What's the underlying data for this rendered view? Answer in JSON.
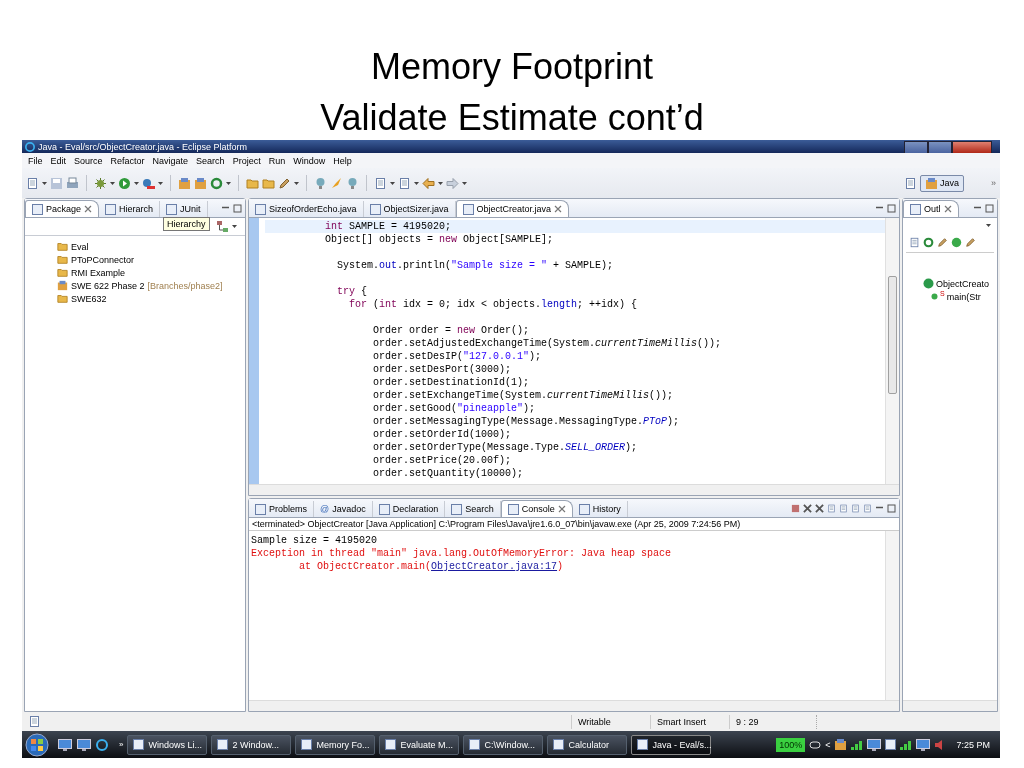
{
  "slide": {
    "title": "Memory Footprint",
    "subtitle": "Validate Estimate cont’d"
  },
  "window": {
    "title": "Java - Eval/src/ObjectCreator.java - Eclipse Platform"
  },
  "menu": [
    "File",
    "Edit",
    "Source",
    "Refactor",
    "Navigate",
    "Search",
    "Project",
    "Run",
    "Window",
    "Help"
  ],
  "perspective": {
    "label": "Java",
    "selected": true,
    "more": "»"
  },
  "package_explorer": {
    "tabs": [
      {
        "label": "Package",
        "selected": true,
        "closable": true
      },
      {
        "label": "Hierarch",
        "selected": false,
        "closable": false
      },
      {
        "label": "JUnit",
        "selected": false,
        "closable": false
      }
    ],
    "tooltip": "Hierarchy",
    "tree": [
      {
        "label": "Eval",
        "kind": "project"
      },
      {
        "label": "PToPConnector",
        "kind": "folder"
      },
      {
        "label": "RMI Example",
        "kind": "folder"
      },
      {
        "label": "SWE 622 Phase 2",
        "decoration": "[Branches/phase2]",
        "kind": "shared"
      },
      {
        "label": "SWE632",
        "kind": "project"
      }
    ]
  },
  "editor": {
    "tabs": [
      {
        "label": "SizeofOrderEcho.java",
        "selected": false,
        "closable": false
      },
      {
        "label": "ObjectSizer.java",
        "selected": false,
        "closable": false
      },
      {
        "label": "ObjectCreator.java",
        "selected": true,
        "closable": true
      }
    ],
    "lines": [
      {
        "kind": "code",
        "current": true,
        "tokens": [
          {
            "text": "          int",
            "kind": "keyword"
          },
          {
            "text": " SAMPLE = 4195020;",
            "kind": "plain"
          }
        ]
      },
      {
        "kind": "code",
        "current": false,
        "tokens": [
          {
            "text": "          Object[] objects = ",
            "kind": "plain"
          },
          {
            "text": "new",
            "kind": "keyword"
          },
          {
            "text": " Object[SAMPLE];",
            "kind": "plain"
          }
        ]
      },
      {
        "kind": "blank"
      },
      {
        "kind": "code",
        "current": false,
        "tokens": [
          {
            "text": "            System.",
            "kind": "plain"
          },
          {
            "text": "out",
            "kind": "field"
          },
          {
            "text": ".println(",
            "kind": "plain"
          },
          {
            "text": "\"Sample size = \"",
            "kind": "string"
          },
          {
            "text": " + SAMPLE);",
            "kind": "plain"
          }
        ]
      },
      {
        "kind": "blank"
      },
      {
        "kind": "code",
        "current": false,
        "tokens": [
          {
            "text": "            try",
            "kind": "keyword"
          },
          {
            "text": " {",
            "kind": "plain"
          }
        ]
      },
      {
        "kind": "code",
        "current": false,
        "tokens": [
          {
            "text": "              for",
            "kind": "keyword"
          },
          {
            "text": " (",
            "kind": "plain"
          },
          {
            "text": "int",
            "kind": "keyword"
          },
          {
            "text": " idx = 0; idx < objects.",
            "kind": "plain"
          },
          {
            "text": "length",
            "kind": "field"
          },
          {
            "text": "; ++idx) {",
            "kind": "plain"
          }
        ]
      },
      {
        "kind": "blank"
      },
      {
        "kind": "code",
        "current": false,
        "tokens": [
          {
            "text": "                  Order order = ",
            "kind": "plain"
          },
          {
            "text": "new",
            "kind": "keyword"
          },
          {
            "text": " Order();",
            "kind": "plain"
          }
        ]
      },
      {
        "kind": "code",
        "current": false,
        "tokens": [
          {
            "text": "                  order.setAdjustedExchangeTime(System.",
            "kind": "plain"
          },
          {
            "text": "currentTimeMillis",
            "kind": "static"
          },
          {
            "text": "());",
            "kind": "plain"
          }
        ]
      },
      {
        "kind": "code",
        "current": false,
        "tokens": [
          {
            "text": "                  order.setDesIP(",
            "kind": "plain"
          },
          {
            "text": "\"127.0.0.1\"",
            "kind": "string"
          },
          {
            "text": ");",
            "kind": "plain"
          }
        ]
      },
      {
        "kind": "code",
        "current": false,
        "tokens": [
          {
            "text": "                  order.setDesPort(3000);",
            "kind": "plain"
          }
        ]
      },
      {
        "kind": "code",
        "current": false,
        "tokens": [
          {
            "text": "                  order.setDestinationId(1);",
            "kind": "plain"
          }
        ]
      },
      {
        "kind": "code",
        "current": false,
        "tokens": [
          {
            "text": "                  order.setExchangeTime(System.",
            "kind": "plain"
          },
          {
            "text": "currentTimeMillis",
            "kind": "static"
          },
          {
            "text": "());",
            "kind": "plain"
          }
        ]
      },
      {
        "kind": "code",
        "current": false,
        "tokens": [
          {
            "text": "                  order.setGood(",
            "kind": "plain"
          },
          {
            "text": "\"pineapple\"",
            "kind": "string"
          },
          {
            "text": ");",
            "kind": "plain"
          }
        ]
      },
      {
        "kind": "code",
        "current": false,
        "tokens": [
          {
            "text": "                  order.setMessagingType(Message.MessagingType.",
            "kind": "plain"
          },
          {
            "text": "PToP",
            "kind": "static-field"
          },
          {
            "text": ");",
            "kind": "plain"
          }
        ]
      },
      {
        "kind": "code",
        "current": false,
        "tokens": [
          {
            "text": "                  order.setOrderId(1000);",
            "kind": "plain"
          }
        ]
      },
      {
        "kind": "code",
        "current": false,
        "tokens": [
          {
            "text": "                  order.setOrderType(Message.Type.",
            "kind": "plain"
          },
          {
            "text": "SELL_ORDER",
            "kind": "static-field"
          },
          {
            "text": ");",
            "kind": "plain"
          }
        ]
      },
      {
        "kind": "code",
        "current": false,
        "tokens": [
          {
            "text": "                  order.setPrice(20.00f);",
            "kind": "plain"
          }
        ]
      },
      {
        "kind": "code",
        "current": false,
        "tokens": [
          {
            "text": "                  order.setQuantity(10000);",
            "kind": "plain"
          }
        ]
      }
    ]
  },
  "outline": {
    "tab": {
      "label": "Outl",
      "selected": true,
      "closable": true
    },
    "tree": [
      {
        "label": "ObjectCreato",
        "kind": "class",
        "children": [
          {
            "label": "main(Str",
            "kind": "method",
            "marker": "S"
          }
        ]
      }
    ]
  },
  "console": {
    "tabs": [
      {
        "label": "Problems",
        "selected": false,
        "closable": false
      },
      {
        "label": "Javadoc",
        "glyph": "@",
        "selected": false,
        "closable": false
      },
      {
        "label": "Declaration",
        "selected": false,
        "closable": false
      },
      {
        "label": "Search",
        "selected": false,
        "closable": false
      },
      {
        "label": "Console",
        "selected": true,
        "closable": true
      },
      {
        "label": "History",
        "selected": false,
        "closable": false
      }
    ],
    "header": "<terminated> ObjectCreator [Java Application] C:\\Program Files\\Java\\jre1.6.0_07\\bin\\javaw.exe (Apr 25, 2009 7:24:56 PM)",
    "lines": [
      {
        "kind": "output",
        "text": "Sample size = 4195020"
      },
      {
        "kind": "error",
        "text": "Exception in thread \"main\" java.lang.OutOfMemoryError: Java heap space"
      },
      {
        "kind": "error",
        "text": "        at ObjectCreator.main(",
        "link": "ObjectCreator.java:17",
        "after": ")"
      }
    ]
  },
  "status_bar": [
    "Writable",
    "Smart Insert",
    "9 : 29"
  ],
  "taskbar": {
    "more": "»",
    "items": [
      {
        "label": "Windows Li...",
        "selected": false
      },
      {
        "label": "2 Window...",
        "selected": false
      },
      {
        "label": "Memory Fo...",
        "selected": false
      },
      {
        "label": "Evaluate M...",
        "selected": false
      },
      {
        "label": "C:\\Window...",
        "selected": false
      },
      {
        "label": "Calculator",
        "selected": false
      },
      {
        "label": "Java - Eval/s...",
        "selected": true
      }
    ],
    "battery": "100%",
    "tray_more": "<",
    "clock": "7:25 PM"
  }
}
